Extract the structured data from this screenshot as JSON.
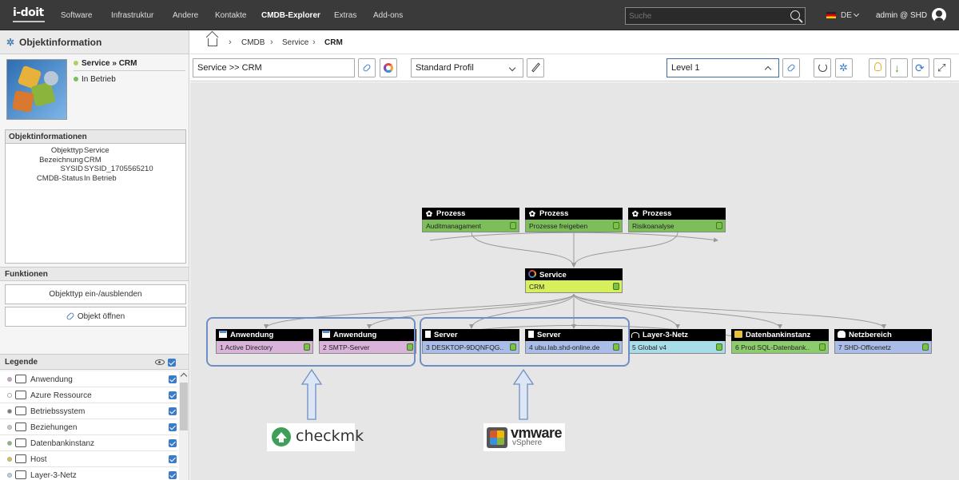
{
  "topbar": {
    "logo": "i-doit",
    "nav": [
      "Software",
      "Infrastruktur",
      "Andere",
      "Kontakte",
      "CMDB-Explorer",
      "Extras",
      "Add-ons"
    ],
    "active_nav": "CMDB-Explorer",
    "search_placeholder": "Suche",
    "language": "DE",
    "user": "admin @ SHD"
  },
  "sidebar": {
    "title": "Objektinformation",
    "object_title": "Service » CRM",
    "object_status": "In Betrieb",
    "info_title": "Objektinformationen",
    "info": [
      {
        "key": "Objekttyp",
        "value": "Service"
      },
      {
        "key": "Bezeichnung",
        "value": "CRM"
      },
      {
        "key": "SYSID",
        "value": "SYSID_1705565210"
      },
      {
        "key": "CMDB-Status",
        "value": "In Betrieb"
      }
    ],
    "functions_title": "Funktionen",
    "toggle_button": "Objekttyp ein-/ausblenden",
    "open_button": "Objekt öffnen",
    "legend_title": "Legende",
    "legend": [
      {
        "label": "Anwendung",
        "dot": "#c9a3c9"
      },
      {
        "label": "Azure Ressource",
        "dot": "#ffffff"
      },
      {
        "label": "Betriebssystem",
        "dot": "#7a7a7a"
      },
      {
        "label": "Beziehungen",
        "dot": "#c8c8c8"
      },
      {
        "label": "Datenbankinstanz",
        "dot": "#7cbf6e"
      },
      {
        "label": "Host",
        "dot": "#e0c040"
      },
      {
        "label": "Layer-3-Netz",
        "dot": "#a8d8e8"
      }
    ]
  },
  "breadcrumb": [
    "CMDB",
    "Service",
    "CRM"
  ],
  "toolbar": {
    "object_field": "Service >> CRM",
    "profile": "Standard Profil",
    "level": "Level 1"
  },
  "graph": {
    "processes": [
      {
        "header": "Prozess",
        "label": "Auditmanagament"
      },
      {
        "header": "Prozess",
        "label": "Prozesse freigeben"
      },
      {
        "header": "Prozess",
        "label": "Risikoanalyse"
      }
    ],
    "service": {
      "header": "Service",
      "label": "CRM"
    },
    "children": [
      {
        "header": "Anwendung",
        "label": "1 Active Directory",
        "color": "#d9b3d9"
      },
      {
        "header": "Anwendung",
        "label": "2 SMTP-Server",
        "color": "#d9b3d9"
      },
      {
        "header": "Server",
        "label": "3 DESKTOP-9DQNFQG..",
        "color": "#a9bde8"
      },
      {
        "header": "Server",
        "label": "4 ubu.lab.shd-online.de",
        "color": "#a9bde8"
      },
      {
        "header": "Layer-3-Netz",
        "label": "5 Global v4",
        "color": "#a8dce8"
      },
      {
        "header": "Datenbankinstanz",
        "label": "6 Prod SQL-Datenbank..",
        "color": "#8ccc6e"
      },
      {
        "header": "Netzbereich",
        "label": "7 SHD-Officenetz",
        "color": "#a9bde8"
      }
    ],
    "colors": {
      "process": "#7cbf5a",
      "service": "#d6ef5a"
    }
  },
  "brands": {
    "checkmk": "checkmk",
    "vmware": "vmware",
    "vsphere": "vSphere"
  }
}
